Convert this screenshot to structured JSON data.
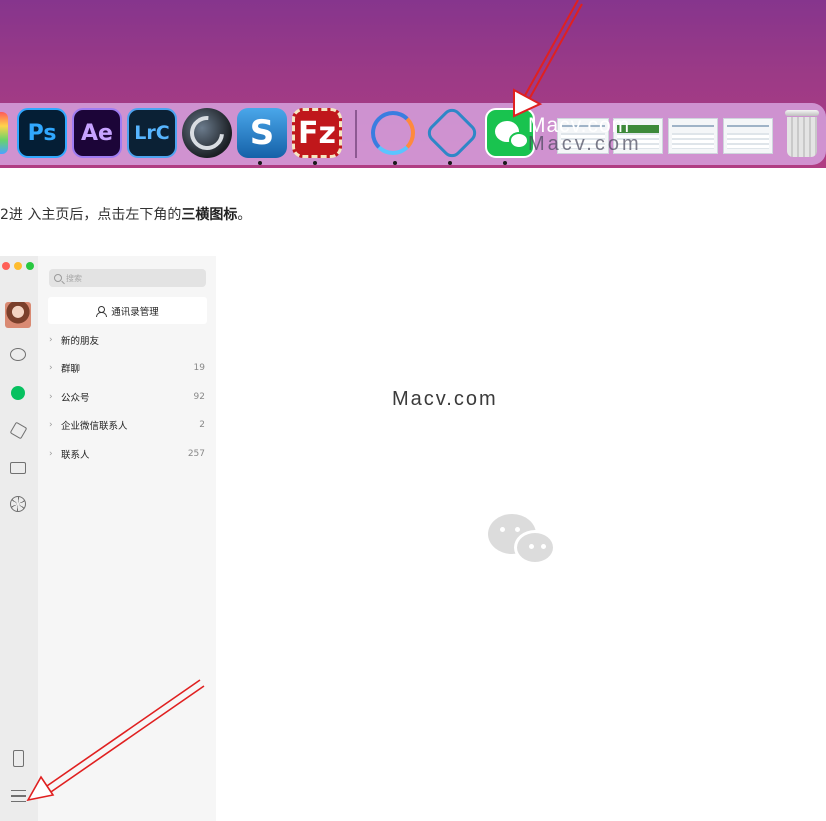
{
  "dock": {
    "apps": [
      {
        "name": "photoshop",
        "label": "Ps"
      },
      {
        "name": "after-effects",
        "label": "Ae"
      },
      {
        "name": "lightroom-classic",
        "label": "LrC"
      },
      {
        "name": "cinema-4d",
        "label": ""
      },
      {
        "name": "screenflow",
        "label": "S"
      },
      {
        "name": "filezilla",
        "label": "Fz"
      },
      {
        "name": "ring-app",
        "label": ""
      },
      {
        "name": "hex-app",
        "label": ""
      },
      {
        "name": "wechat",
        "label": ""
      }
    ],
    "watermark_top": "Macv.com",
    "watermark_bottom": "Macv.com",
    "accent_color": "#e02020"
  },
  "instruction": {
    "prefix": "2进 入主页后，点击左下角的",
    "bold": "三横图标",
    "suffix": "。"
  },
  "wechat": {
    "search": {
      "placeholder": "搜索"
    },
    "manage_button": "通讯录管理",
    "groups": [
      {
        "label": "新的朋友",
        "count": ""
      },
      {
        "label": "群聊",
        "count": "19"
      },
      {
        "label": "公众号",
        "count": "92"
      },
      {
        "label": "企业微信联系人",
        "count": "2"
      },
      {
        "label": "联系人",
        "count": "257"
      }
    ],
    "watermark": "Macv.com",
    "brand_color": "#07c160"
  }
}
